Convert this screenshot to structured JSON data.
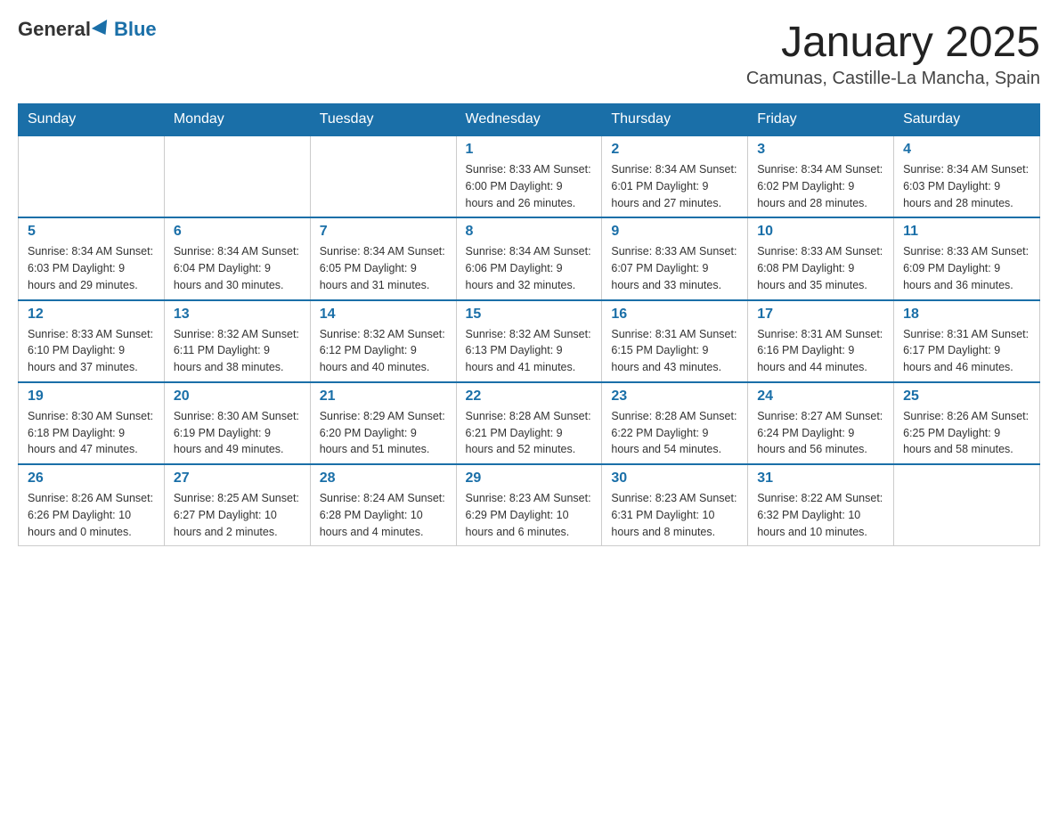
{
  "header": {
    "logo_general": "General",
    "logo_blue": "Blue",
    "month_title": "January 2025",
    "location": "Camunas, Castille-La Mancha, Spain"
  },
  "days_of_week": [
    "Sunday",
    "Monday",
    "Tuesday",
    "Wednesday",
    "Thursday",
    "Friday",
    "Saturday"
  ],
  "weeks": [
    [
      {
        "day": "",
        "info": ""
      },
      {
        "day": "",
        "info": ""
      },
      {
        "day": "",
        "info": ""
      },
      {
        "day": "1",
        "info": "Sunrise: 8:33 AM\nSunset: 6:00 PM\nDaylight: 9 hours and 26 minutes."
      },
      {
        "day": "2",
        "info": "Sunrise: 8:34 AM\nSunset: 6:01 PM\nDaylight: 9 hours and 27 minutes."
      },
      {
        "day": "3",
        "info": "Sunrise: 8:34 AM\nSunset: 6:02 PM\nDaylight: 9 hours and 28 minutes."
      },
      {
        "day": "4",
        "info": "Sunrise: 8:34 AM\nSunset: 6:03 PM\nDaylight: 9 hours and 28 minutes."
      }
    ],
    [
      {
        "day": "5",
        "info": "Sunrise: 8:34 AM\nSunset: 6:03 PM\nDaylight: 9 hours and 29 minutes."
      },
      {
        "day": "6",
        "info": "Sunrise: 8:34 AM\nSunset: 6:04 PM\nDaylight: 9 hours and 30 minutes."
      },
      {
        "day": "7",
        "info": "Sunrise: 8:34 AM\nSunset: 6:05 PM\nDaylight: 9 hours and 31 minutes."
      },
      {
        "day": "8",
        "info": "Sunrise: 8:34 AM\nSunset: 6:06 PM\nDaylight: 9 hours and 32 minutes."
      },
      {
        "day": "9",
        "info": "Sunrise: 8:33 AM\nSunset: 6:07 PM\nDaylight: 9 hours and 33 minutes."
      },
      {
        "day": "10",
        "info": "Sunrise: 8:33 AM\nSunset: 6:08 PM\nDaylight: 9 hours and 35 minutes."
      },
      {
        "day": "11",
        "info": "Sunrise: 8:33 AM\nSunset: 6:09 PM\nDaylight: 9 hours and 36 minutes."
      }
    ],
    [
      {
        "day": "12",
        "info": "Sunrise: 8:33 AM\nSunset: 6:10 PM\nDaylight: 9 hours and 37 minutes."
      },
      {
        "day": "13",
        "info": "Sunrise: 8:32 AM\nSunset: 6:11 PM\nDaylight: 9 hours and 38 minutes."
      },
      {
        "day": "14",
        "info": "Sunrise: 8:32 AM\nSunset: 6:12 PM\nDaylight: 9 hours and 40 minutes."
      },
      {
        "day": "15",
        "info": "Sunrise: 8:32 AM\nSunset: 6:13 PM\nDaylight: 9 hours and 41 minutes."
      },
      {
        "day": "16",
        "info": "Sunrise: 8:31 AM\nSunset: 6:15 PM\nDaylight: 9 hours and 43 minutes."
      },
      {
        "day": "17",
        "info": "Sunrise: 8:31 AM\nSunset: 6:16 PM\nDaylight: 9 hours and 44 minutes."
      },
      {
        "day": "18",
        "info": "Sunrise: 8:31 AM\nSunset: 6:17 PM\nDaylight: 9 hours and 46 minutes."
      }
    ],
    [
      {
        "day": "19",
        "info": "Sunrise: 8:30 AM\nSunset: 6:18 PM\nDaylight: 9 hours and 47 minutes."
      },
      {
        "day": "20",
        "info": "Sunrise: 8:30 AM\nSunset: 6:19 PM\nDaylight: 9 hours and 49 minutes."
      },
      {
        "day": "21",
        "info": "Sunrise: 8:29 AM\nSunset: 6:20 PM\nDaylight: 9 hours and 51 minutes."
      },
      {
        "day": "22",
        "info": "Sunrise: 8:28 AM\nSunset: 6:21 PM\nDaylight: 9 hours and 52 minutes."
      },
      {
        "day": "23",
        "info": "Sunrise: 8:28 AM\nSunset: 6:22 PM\nDaylight: 9 hours and 54 minutes."
      },
      {
        "day": "24",
        "info": "Sunrise: 8:27 AM\nSunset: 6:24 PM\nDaylight: 9 hours and 56 minutes."
      },
      {
        "day": "25",
        "info": "Sunrise: 8:26 AM\nSunset: 6:25 PM\nDaylight: 9 hours and 58 minutes."
      }
    ],
    [
      {
        "day": "26",
        "info": "Sunrise: 8:26 AM\nSunset: 6:26 PM\nDaylight: 10 hours and 0 minutes."
      },
      {
        "day": "27",
        "info": "Sunrise: 8:25 AM\nSunset: 6:27 PM\nDaylight: 10 hours and 2 minutes."
      },
      {
        "day": "28",
        "info": "Sunrise: 8:24 AM\nSunset: 6:28 PM\nDaylight: 10 hours and 4 minutes."
      },
      {
        "day": "29",
        "info": "Sunrise: 8:23 AM\nSunset: 6:29 PM\nDaylight: 10 hours and 6 minutes."
      },
      {
        "day": "30",
        "info": "Sunrise: 8:23 AM\nSunset: 6:31 PM\nDaylight: 10 hours and 8 minutes."
      },
      {
        "day": "31",
        "info": "Sunrise: 8:22 AM\nSunset: 6:32 PM\nDaylight: 10 hours and 10 minutes."
      },
      {
        "day": "",
        "info": ""
      }
    ]
  ]
}
